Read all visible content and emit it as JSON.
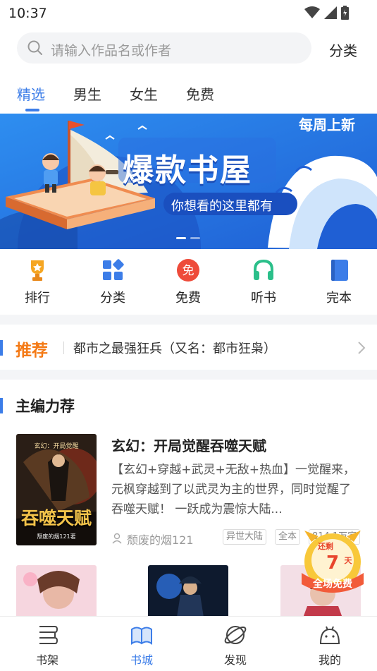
{
  "status_bar": {
    "time": "10:37"
  },
  "search": {
    "placeholder": "请输入作品名或作者",
    "category_label": "分类"
  },
  "tabs": [
    {
      "label": "精选",
      "active": true
    },
    {
      "label": "男生",
      "active": false
    },
    {
      "label": "女生",
      "active": false
    },
    {
      "label": "免费",
      "active": false
    }
  ],
  "banner": {
    "title": "爆款书屋",
    "subtitle": "你想看的这里都有",
    "badge": "每周上新",
    "page_indicator": {
      "current": 1,
      "total": 2
    }
  },
  "quick_entries": [
    {
      "label": "排行",
      "icon": "trophy-icon",
      "color": "#f5a623"
    },
    {
      "label": "分类",
      "icon": "grid-icon",
      "color": "#3c7de8"
    },
    {
      "label": "免费",
      "icon": "free-icon",
      "color": "#ee4b3a"
    },
    {
      "label": "听书",
      "icon": "headphones-icon",
      "color": "#2bbf8a"
    },
    {
      "label": "完本",
      "icon": "book-icon",
      "color": "#3c7de8"
    }
  ],
  "recommend": {
    "tag": "推荐",
    "text": "都市之最强狂兵（又名：都市狂枭）"
  },
  "section": {
    "title": "主编力荐"
  },
  "featured_book": {
    "title": "玄幻：开局觉醒吞噬天赋",
    "description": "【玄幻+穿越+武灵+无敌+热血】一觉醒来，元枫穿越到了以武灵为主的世界，同时觉醒了吞噬天赋！ 一跃成为震惊大陆...",
    "author": "颓废的烟121",
    "tags": [
      "异世大陆",
      "全本",
      "814.1万字"
    ],
    "cover": {
      "top_text": "玄幻：开局觉醒",
      "title": "吞噬天赋",
      "author": "颓废的烟121著"
    }
  },
  "promo": {
    "top": "还剩",
    "days": "7",
    "unit": "天",
    "bottom": "全场免费"
  },
  "bottom_nav": [
    {
      "label": "书架",
      "icon": "bookshelf-icon",
      "active": false
    },
    {
      "label": "书城",
      "icon": "bookstore-icon",
      "active": true
    },
    {
      "label": "发现",
      "icon": "planet-icon",
      "active": false
    },
    {
      "label": "我的",
      "icon": "profile-icon",
      "active": false
    }
  ],
  "colors": {
    "accent": "#3c7de8",
    "recommend": "#f47a16",
    "divider": "#f4f5f7"
  }
}
